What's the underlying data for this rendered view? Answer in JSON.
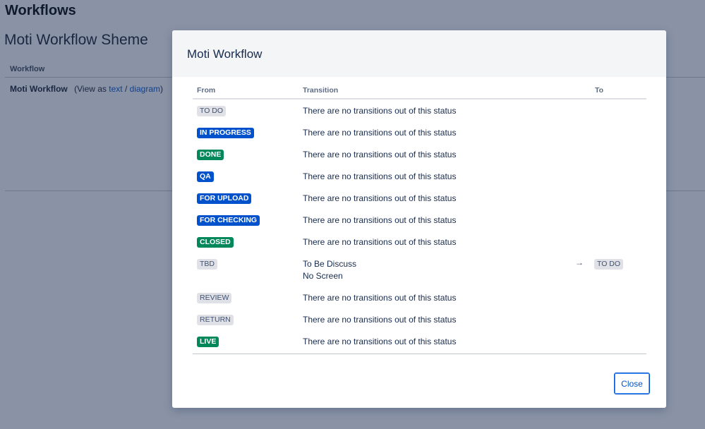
{
  "background": {
    "page_title": "Workflows",
    "scheme_title": "Moti Workflow Sheme",
    "column_header": "Workflow",
    "workflow_name": "Moti Workflow",
    "view_prefix": "(View as",
    "view_text_link": "text",
    "view_separator": "/",
    "view_diagram_link": "diagram",
    "view_suffix": ")"
  },
  "modal": {
    "title": "Moti Workflow",
    "columns": {
      "from": "From",
      "transition": "Transition",
      "to": "To"
    },
    "rows": [
      {
        "from": "TO DO",
        "from_style": "default",
        "transition": "There are no transitions out of this status"
      },
      {
        "from": "IN PROGRESS",
        "from_style": "blue",
        "transition": "There are no transitions out of this status"
      },
      {
        "from": "DONE",
        "from_style": "green",
        "transition": "There are no transitions out of this status"
      },
      {
        "from": "QA",
        "from_style": "blue",
        "transition": "There are no transitions out of this status"
      },
      {
        "from": "FOR UPLOAD",
        "from_style": "blue",
        "transition": "There are no transitions out of this status"
      },
      {
        "from": "FOR CHECKING",
        "from_style": "blue",
        "transition": "There are no transitions out of this status"
      },
      {
        "from": "CLOSED",
        "from_style": "green",
        "transition": "There are no transitions out of this status"
      },
      {
        "from": "TBD",
        "from_style": "default",
        "transition": "To Be Discuss",
        "transition_sub": "No Screen",
        "arrow": "→",
        "to": "TO DO",
        "to_style": "default"
      },
      {
        "from": "REVIEW",
        "from_style": "default",
        "transition": "There are no transitions out of this status"
      },
      {
        "from": "RETURN",
        "from_style": "default",
        "transition": "There are no transitions out of this status"
      },
      {
        "from": "LIVE",
        "from_style": "green",
        "transition": "There are no transitions out of this status"
      }
    ],
    "close_label": "Close"
  },
  "colors": {
    "overlay_background": "#8a93a6",
    "lozenge_blue": "#0052cc",
    "lozenge_green": "#00875a",
    "lozenge_default": "#dfe1e6",
    "link": "#0052cc"
  }
}
